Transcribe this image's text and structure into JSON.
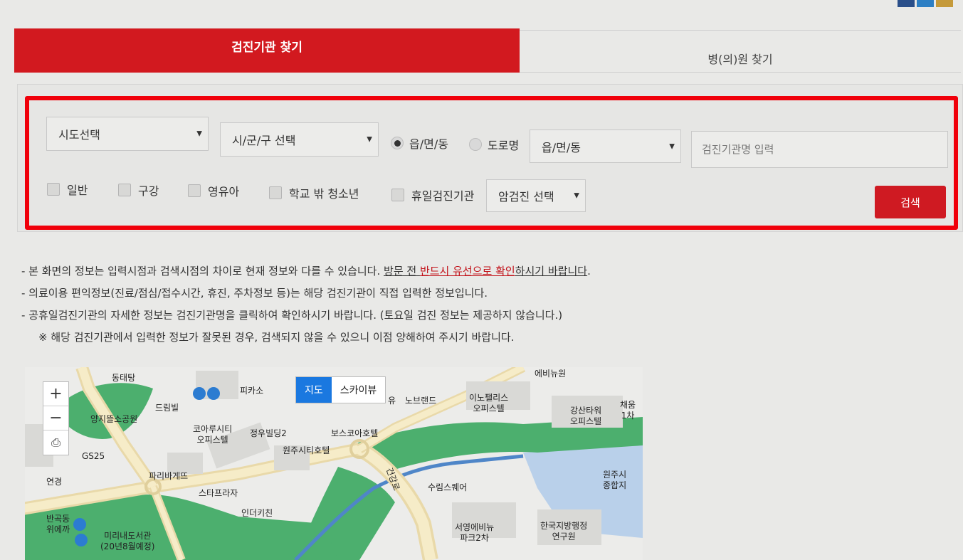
{
  "tabs": {
    "active": "검진기관 찾기",
    "inactive": "병(의)원 찾기"
  },
  "search": {
    "sido_select": "시도선택",
    "sigungu_select": "시/군/구 선택",
    "radio_dong": "읍/면/동",
    "radio_road": "도로명",
    "dong_select": "읍/면/동",
    "name_placeholder": "검진기관명 입력",
    "checks": [
      "일반",
      "구강",
      "영유아",
      "학교 밖 청소년",
      "휴일검진기관"
    ],
    "cancer_select": "암검진 선택",
    "search_button": "검색"
  },
  "notes": {
    "line1_a": "- 본 화면의 정보는 입력시점과 검색시점의 차이로 현재 정보와 다를 수 있습니다.  ",
    "line1_b": "방문 전 ",
    "line1_c": "반드시 유선으로 확인",
    "line1_d": "하시기 바랍니다",
    "line1_e": ".",
    "line2": "- 의료이용 편익정보(진료/점심/접수시간, 휴진, 주차정보 등)는 해당 검진기관이 직접 입력한 정보입니다.",
    "line3": "- 공휴일검진기관의 자세한 정보는 검진기관명을 클릭하여 확인하시기 바랍니다. (토요일 검진 정보는 제공하지 않습니다.)",
    "line4": "※  해당 검진기관에서 입력한 정보가 잘못된 경우, 검색되지 않을 수 있으니 이점 양해하여 주시기 바랍니다."
  },
  "map": {
    "zoom_in": "+",
    "zoom_out": "−",
    "print": "⎙",
    "type_map": "지도",
    "type_sky": "스카이뷰",
    "labels": {
      "l1": "동태탕",
      "l2": "양지뜰소공원",
      "l3": "드림빌",
      "l4": "피카소",
      "l5": "노브랜드",
      "l6": "이노팰리스\n오피스텔",
      "l7": "강산타워\n오피스텔",
      "l8": "채움\n1차",
      "l9": "GS25",
      "l10": "코아루시티\n오피스텔",
      "l11": "정우빌딩2",
      "l12": "보스코아호텔",
      "l13": "원주시티호텔",
      "l14": "파리바게뜨",
      "l15": "연경",
      "l16": "스타프라자",
      "l17": "건강로",
      "l18": "수림스퀘어",
      "l19": "원주시\n종합지",
      "l20": "인더키친",
      "l21": "반곡동\n위에까",
      "l22": "미리내도서관\n(20년8월예정)",
      "l23": "서영에비뉴\n파크2차",
      "l24": "한국지방행정\n연구원",
      "l25": "에비뉴원",
      "l26": "유"
    }
  }
}
